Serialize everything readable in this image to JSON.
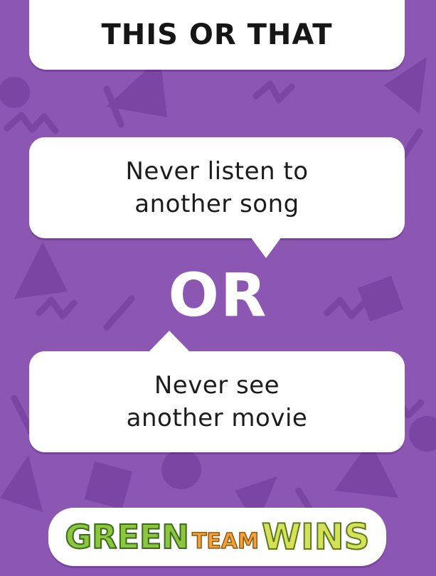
{
  "header": {
    "title": "THIS OR THAT"
  },
  "options": {
    "first": "Never listen to\nanother song",
    "separator": "OR",
    "second": "Never see\nanother movie"
  },
  "logo": {
    "word1": "GREEN",
    "word2": "TEAM",
    "word3": "WINS"
  },
  "colors": {
    "background": "#8b57b2",
    "card": "#ffffff",
    "logo_green": "#8cc63e",
    "logo_orange": "#f4a13a"
  }
}
